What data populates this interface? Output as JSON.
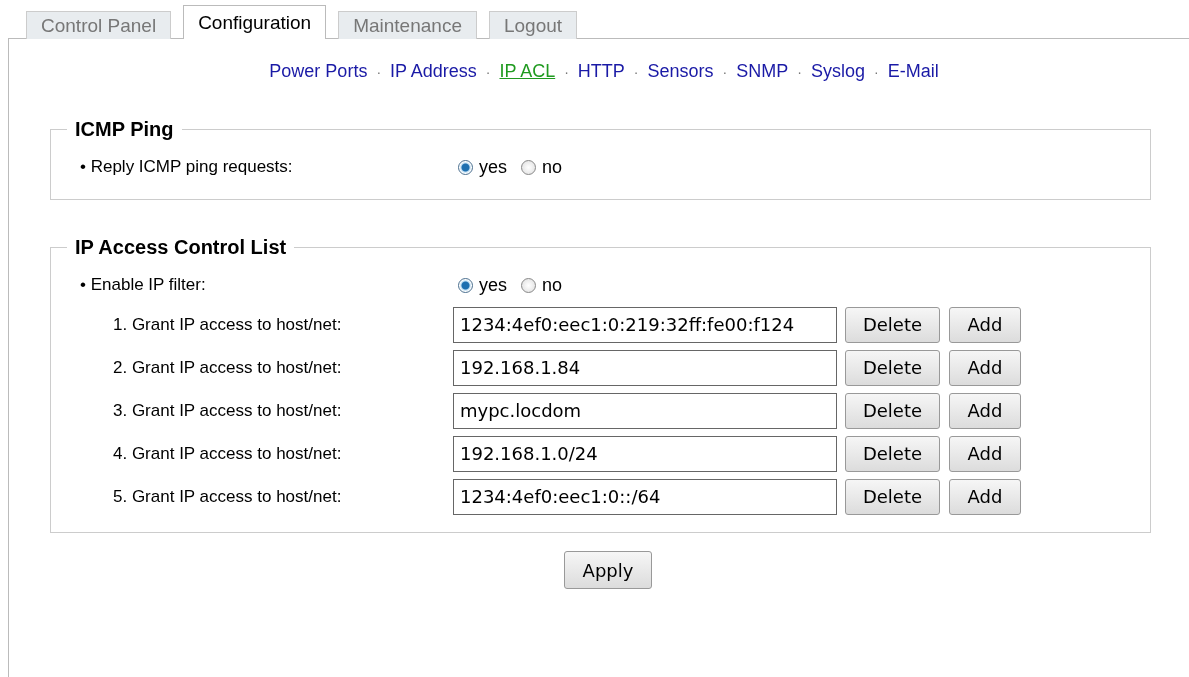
{
  "tabs": [
    {
      "label": "Control Panel",
      "selected": false
    },
    {
      "label": "Configuration",
      "selected": true
    },
    {
      "label": "Maintenance",
      "selected": false
    },
    {
      "label": "Logout",
      "selected": false
    }
  ],
  "subnav": [
    {
      "kind": "link",
      "label": "Power Ports",
      "selected": false
    },
    {
      "kind": "separator",
      "label": "·"
    },
    {
      "kind": "link",
      "label": "IP Address",
      "selected": false
    },
    {
      "kind": "separator",
      "label": "·"
    },
    {
      "kind": "link",
      "label": "IP ACL",
      "selected": true
    },
    {
      "kind": "separator",
      "label": "·"
    },
    {
      "kind": "link",
      "label": "HTTP",
      "selected": false
    },
    {
      "kind": "separator",
      "label": "·"
    },
    {
      "kind": "link",
      "label": "Sensors",
      "selected": false
    },
    {
      "kind": "separator",
      "label": "·"
    },
    {
      "kind": "link",
      "label": "SNMP",
      "selected": false
    },
    {
      "kind": "separator",
      "label": "·"
    },
    {
      "kind": "link",
      "label": "Syslog",
      "selected": false
    },
    {
      "kind": "separator",
      "label": "·"
    },
    {
      "kind": "link",
      "label": "E-Mail",
      "selected": false
    }
  ],
  "sections": [
    {
      "title": "ICMP Ping",
      "rows": [
        {
          "kind": "radio",
          "label": "• Reply ICMP ping requests:",
          "options": [
            {
              "label": "yes",
              "selected": true
            },
            {
              "label": "no",
              "selected": false
            }
          ]
        }
      ]
    },
    {
      "title": "IP Access Control List",
      "rows": [
        {
          "kind": "radio",
          "label": "• Enable IP filter:",
          "options": [
            {
              "label": "yes",
              "selected": true
            },
            {
              "label": "no",
              "selected": false
            }
          ]
        },
        {
          "kind": "entry",
          "label": "1. Grant IP access to host/net:",
          "value": "1234:4ef0:eec1:0:219:32ff:fe00:f124",
          "buttons": [
            "Delete",
            "Add"
          ]
        },
        {
          "kind": "entry",
          "label": "2. Grant IP access to host/net:",
          "value": "192.168.1.84",
          "buttons": [
            "Delete",
            "Add"
          ]
        },
        {
          "kind": "entry",
          "label": "3. Grant IP access to host/net:",
          "value": "mypc.locdom",
          "buttons": [
            "Delete",
            "Add"
          ]
        },
        {
          "kind": "entry",
          "label": "4. Grant IP access to host/net:",
          "value": "192.168.1.0/24",
          "buttons": [
            "Delete",
            "Add"
          ]
        },
        {
          "kind": "entry",
          "label": "5. Grant IP access to host/net:",
          "value": "1234:4ef0:eec1:0::/64",
          "buttons": [
            "Delete",
            "Add"
          ]
        }
      ]
    }
  ],
  "apply_button": "Apply"
}
